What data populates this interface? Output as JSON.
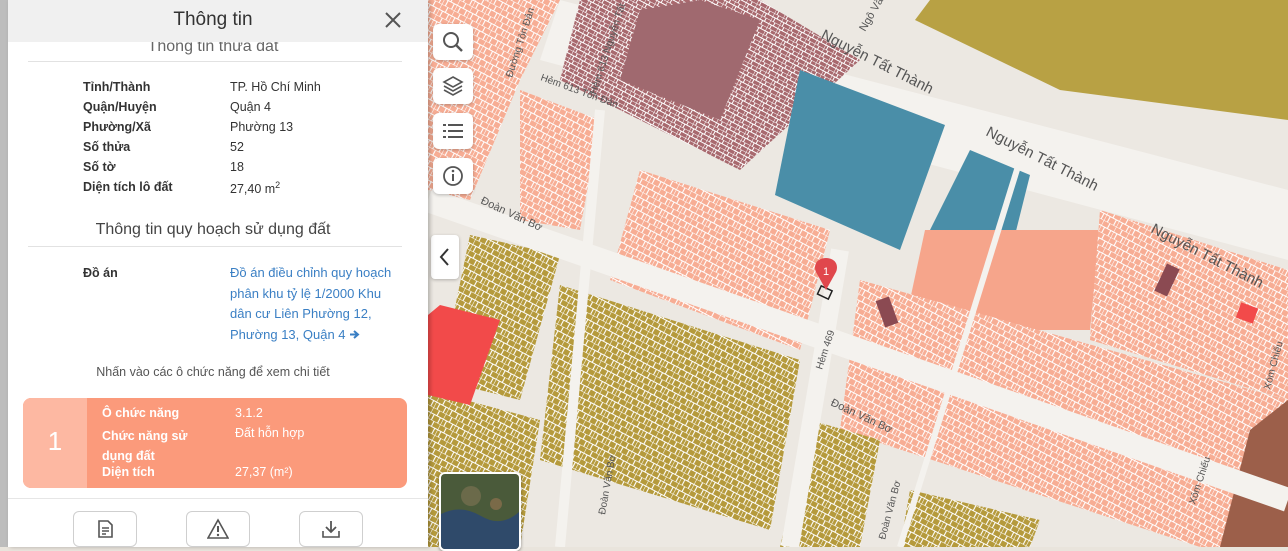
{
  "panel": {
    "title": "Thông tin",
    "land_section_title": "Thông tin thửa đất",
    "land_info": [
      {
        "label": "Tỉnh/Thành",
        "value": "TP. Hồ Chí Minh"
      },
      {
        "label": "Quận/Huyện",
        "value": "Quận 4"
      },
      {
        "label": "Phường/Xã",
        "value": "Phường 13"
      },
      {
        "label": "Số thửa",
        "value": "52"
      },
      {
        "label": "Số tờ",
        "value": "18"
      },
      {
        "label": "Diện tích lô đất",
        "value": "27,40 m",
        "unit_sup": "2"
      }
    ],
    "planning_section_title": "Thông tin quy hoạch sử dụng đất",
    "project_label": "Đồ án",
    "project_link": "Đồ án điều chỉnh quy hoạch phân khu tỷ lệ 1/2000 Khu dân cư Liên Phường 12, Phường 13, Quận 4",
    "hint": "Nhấn vào các ô chức năng để xem chi tiết",
    "zone_card": {
      "number": "1",
      "rows": [
        {
          "label": "Ô chức năng",
          "value": "3.1.2"
        },
        {
          "label": "Chức năng sử dụng đất",
          "value": "Đất hỗn hợp"
        },
        {
          "label": "Diện tích",
          "value": "27,37 (m²)"
        }
      ],
      "color": "#fb9a7b"
    }
  },
  "toolbar": {
    "icons": [
      "search-icon",
      "layers-icon",
      "list-icon",
      "info-icon"
    ]
  },
  "map": {
    "street_labels": [
      "Nguyễn Tất Thành",
      "Nguyễn Tất Thành",
      "Nguyễn Tất Thành",
      "Ngô Văn",
      "Đoàn Văn Bơ",
      "Đoàn Văn Bơ",
      "Đường Tôn Đản",
      "Hẻm 613 Tôn Đản",
      "Hẻm 613 Nguyễn Tất",
      "Hẻm 469",
      "Xóm Chiếu",
      "Xóm Chiếu",
      "Đoàn Văn Bơ",
      "Đoàn Văn Bơ"
    ],
    "marker_label": "1",
    "colors": {
      "residential": "#f6a58b",
      "mixed": "#b89a3e",
      "commercial": "#f24a4a",
      "industrial": "#4a8ea8",
      "green_brown": "#b8a144",
      "dark_brown": "#a0696f"
    }
  }
}
